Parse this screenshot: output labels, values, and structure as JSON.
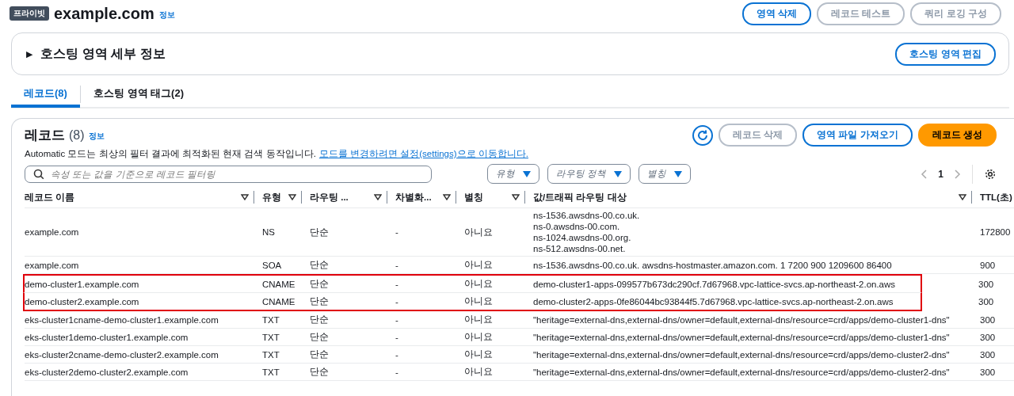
{
  "header": {
    "badge": "프라이빗",
    "title": "example.com",
    "info": "정보",
    "buttons": [
      {
        "label": "영역 삭제",
        "kind": "primary-outline"
      },
      {
        "label": "레코드 테스트",
        "kind": "normal"
      },
      {
        "label": "쿼리 로깅 구성",
        "kind": "normal"
      }
    ]
  },
  "details_panel": {
    "toggle": "▶",
    "title": "호스팅 영역 세부 정보",
    "button": "호스팅 영역 편집"
  },
  "tabs": [
    {
      "label": "레코드(8)",
      "selected": true
    },
    {
      "label": "호스팅 영역 태그(2)",
      "selected": false
    }
  ],
  "records": {
    "title": "레코드",
    "count": "(8)",
    "info": "정보",
    "description": "Automatic 모드는 최상의 필터 결과에 최적화된 현재 검색 동작입니다.",
    "description_link": "모드를 변경하려면 설정(settings)으로 이동합니다.",
    "buttons": [
      {
        "label": "레코드 삭제",
        "kind": "disabled"
      },
      {
        "label": "영역 파일 가져오기",
        "kind": "primary-outline"
      },
      {
        "label": "레코드 생성",
        "kind": "primary"
      }
    ],
    "search": {
      "placeholder": "속성 또는 값을 기준으로 레코드 필터링"
    },
    "filters": [
      "유형",
      "라우팅 정책",
      "별칭"
    ],
    "page": "1",
    "columns": [
      "레코드 이름",
      "유형",
      "라우팅 ...",
      "차별화...",
      "별칭",
      "값/트래픽 라우팅 대상",
      "TTL(초)"
    ],
    "rows": [
      {
        "name": "example.com",
        "type": "NS",
        "routing": "단순",
        "diff": "-",
        "alias": "아니요",
        "values": [
          "ns-1536.awsdns-00.co.uk.",
          "ns-0.awsdns-00.com.",
          "ns-1024.awsdns-00.org.",
          "ns-512.awsdns-00.net."
        ],
        "ttl": "172800",
        "highlighted": false
      },
      {
        "name": "example.com",
        "type": "SOA",
        "routing": "단순",
        "diff": "-",
        "alias": "아니요",
        "values": [
          "ns-1536.awsdns-00.co.uk. awsdns-hostmaster.amazon.com. 1 7200 900 1209600 86400"
        ],
        "ttl": "900",
        "highlighted": false
      },
      {
        "name": "demo-cluster1.example.com",
        "type": "CNAME",
        "routing": "단순",
        "diff": "-",
        "alias": "아니요",
        "values": [
          "demo-cluster1-apps-099577b673dc290cf.7d67968.vpc-lattice-svcs.ap-northeast-2.on.aws"
        ],
        "ttl": "300",
        "highlighted": true
      },
      {
        "name": "demo-cluster2.example.com",
        "type": "CNAME",
        "routing": "단순",
        "diff": "-",
        "alias": "아니요",
        "values": [
          "demo-cluster2-apps-0fe86044bc93844f5.7d67968.vpc-lattice-svcs.ap-northeast-2.on.aws"
        ],
        "ttl": "300",
        "highlighted": true
      },
      {
        "name": "eks-cluster1cname-demo-cluster1.example.com",
        "type": "TXT",
        "routing": "단순",
        "diff": "-",
        "alias": "아니요",
        "values": [
          "\"heritage=external-dns,external-dns/owner=default,external-dns/resource=crd/apps/demo-cluster1-dns\""
        ],
        "ttl": "300",
        "highlighted": false
      },
      {
        "name": "eks-cluster1demo-cluster1.example.com",
        "type": "TXT",
        "routing": "단순",
        "diff": "-",
        "alias": "아니요",
        "values": [
          "\"heritage=external-dns,external-dns/owner=default,external-dns/resource=crd/apps/demo-cluster1-dns\""
        ],
        "ttl": "300",
        "highlighted": false
      },
      {
        "name": "eks-cluster2cname-demo-cluster2.example.com",
        "type": "TXT",
        "routing": "단순",
        "diff": "-",
        "alias": "아니요",
        "values": [
          "\"heritage=external-dns,external-dns/owner=default,external-dns/resource=crd/apps/demo-cluster2-dns\""
        ],
        "ttl": "300",
        "highlighted": false
      },
      {
        "name": "eks-cluster2demo-cluster2.example.com",
        "type": "TXT",
        "routing": "단순",
        "diff": "-",
        "alias": "아니요",
        "values": [
          "\"heritage=external-dns,external-dns/owner=default,external-dns/resource=crd/apps/demo-cluster2-dns\""
        ],
        "ttl": "300",
        "highlighted": false
      }
    ]
  }
}
